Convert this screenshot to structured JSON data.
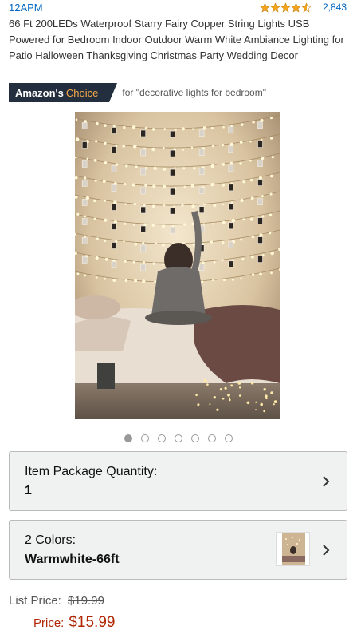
{
  "product": {
    "brand": "12APM",
    "review_count": "2,843",
    "title": "66 Ft 200LEDs Waterproof Starry Fairy Copper String Lights USB Powered for Bedroom Indoor Outdoor Warm White Ambiance Lighting for Patio Halloween Thanksgiving Christmas Party Wedding Decor"
  },
  "badge": {
    "prefix": "Amazon's",
    "accent": "Choice",
    "query": "for \"decorative lights for bedroom\""
  },
  "gallery": {
    "image_count": 7,
    "active_index": 0
  },
  "options": {
    "quantity_label": "Item Package Quantity:",
    "quantity_value": "1",
    "colors_label": "2 Colors:",
    "colors_value": "Warmwhite-66ft"
  },
  "pricing": {
    "list_label": "List Price:",
    "list_value": "$19.99",
    "price_label": "Price:",
    "price_value": "$15.99"
  },
  "colors": {
    "link": "#0066c0",
    "star": "#f4a41d",
    "badge_bg": "#232f3e",
    "badge_accent": "#f3a847",
    "price": "#b12704"
  }
}
